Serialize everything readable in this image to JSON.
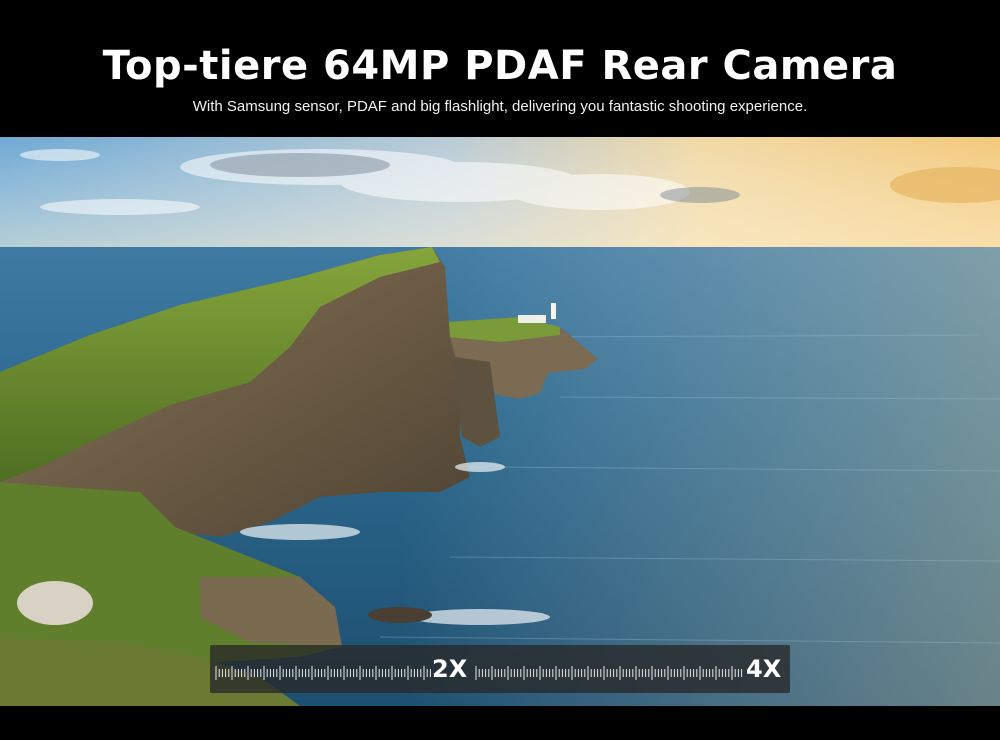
{
  "header": {
    "title": "Top-tiere 64MP PDAF Rear Camera",
    "subtitle": "With Samsung sensor, PDAF and big flashlight, delivering you fantastic shooting experience."
  },
  "photo": {
    "scene": "coastal-cliff-lighthouse",
    "colors": {
      "sky_top": "#7fb4d8",
      "sky_glow": "#f3d9a0",
      "sea_deep": "#1e4f74",
      "sea_light": "#6f9fb8",
      "cliff_rock": "#7b6a52",
      "grass": "#6f8f2e"
    }
  },
  "zoom_bar": {
    "levels": [
      "2X",
      "4X"
    ],
    "background": "#282828"
  }
}
